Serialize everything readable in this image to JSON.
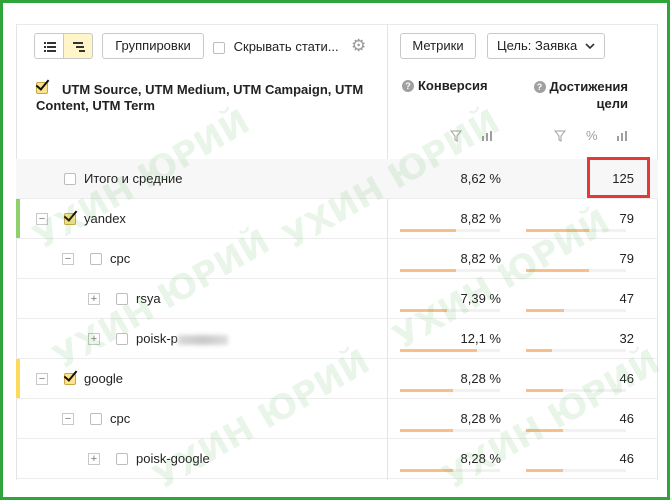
{
  "toolbar": {
    "view_list_icon": "list-icon",
    "view_tree_icon": "tree-icon",
    "groupings_label": "Группировки",
    "hide_stats_label": "Скрывать стати...",
    "metrics_label": "Метрики",
    "goal_label": "Цель: Заявка"
  },
  "header": {
    "dimensions_label": "UTM Source, UTM Medium, UTM Campaign, UTM Content, UTM Term",
    "col1_title": "Конверсия",
    "col2_title": "Достижения цели",
    "percent_symbol": "%"
  },
  "rows": [
    {
      "label": "Итого и средние",
      "conversion": "8,62 %",
      "goals": "125"
    },
    {
      "label": "yandex",
      "conversion": "8,82 %",
      "goals": "79"
    },
    {
      "label": "cpc",
      "conversion": "8,82 %",
      "goals": "79"
    },
    {
      "label": "rsya",
      "conversion": "7,39 %",
      "goals": "47"
    },
    {
      "label": "poisk-p",
      "conversion": "12,1 %",
      "goals": "32"
    },
    {
      "label": "google",
      "conversion": "8,28 %",
      "goals": "46"
    },
    {
      "label": "cpc",
      "conversion": "8,28 %",
      "goals": "46"
    },
    {
      "label": "poisk-google",
      "conversion": "8,28 %",
      "goals": "46"
    }
  ],
  "bars": {
    "conversion_fraction": [
      0,
      0.56,
      0.56,
      0.47,
      0.77,
      0.53,
      0.53,
      0.53
    ],
    "goals_fraction": [
      0,
      0.63,
      0.63,
      0.38,
      0.26,
      0.37,
      0.37,
      0.37
    ]
  },
  "watermark": "УХИН ЮРИЙ",
  "colors": {
    "frame": "#2ea43a",
    "highlight_box": "#e53935",
    "yandex_marker": "#8ed16a",
    "google_marker": "#ffd95a",
    "bar_orange": "#f7c08a",
    "bar_track": "#f2f2f2"
  }
}
